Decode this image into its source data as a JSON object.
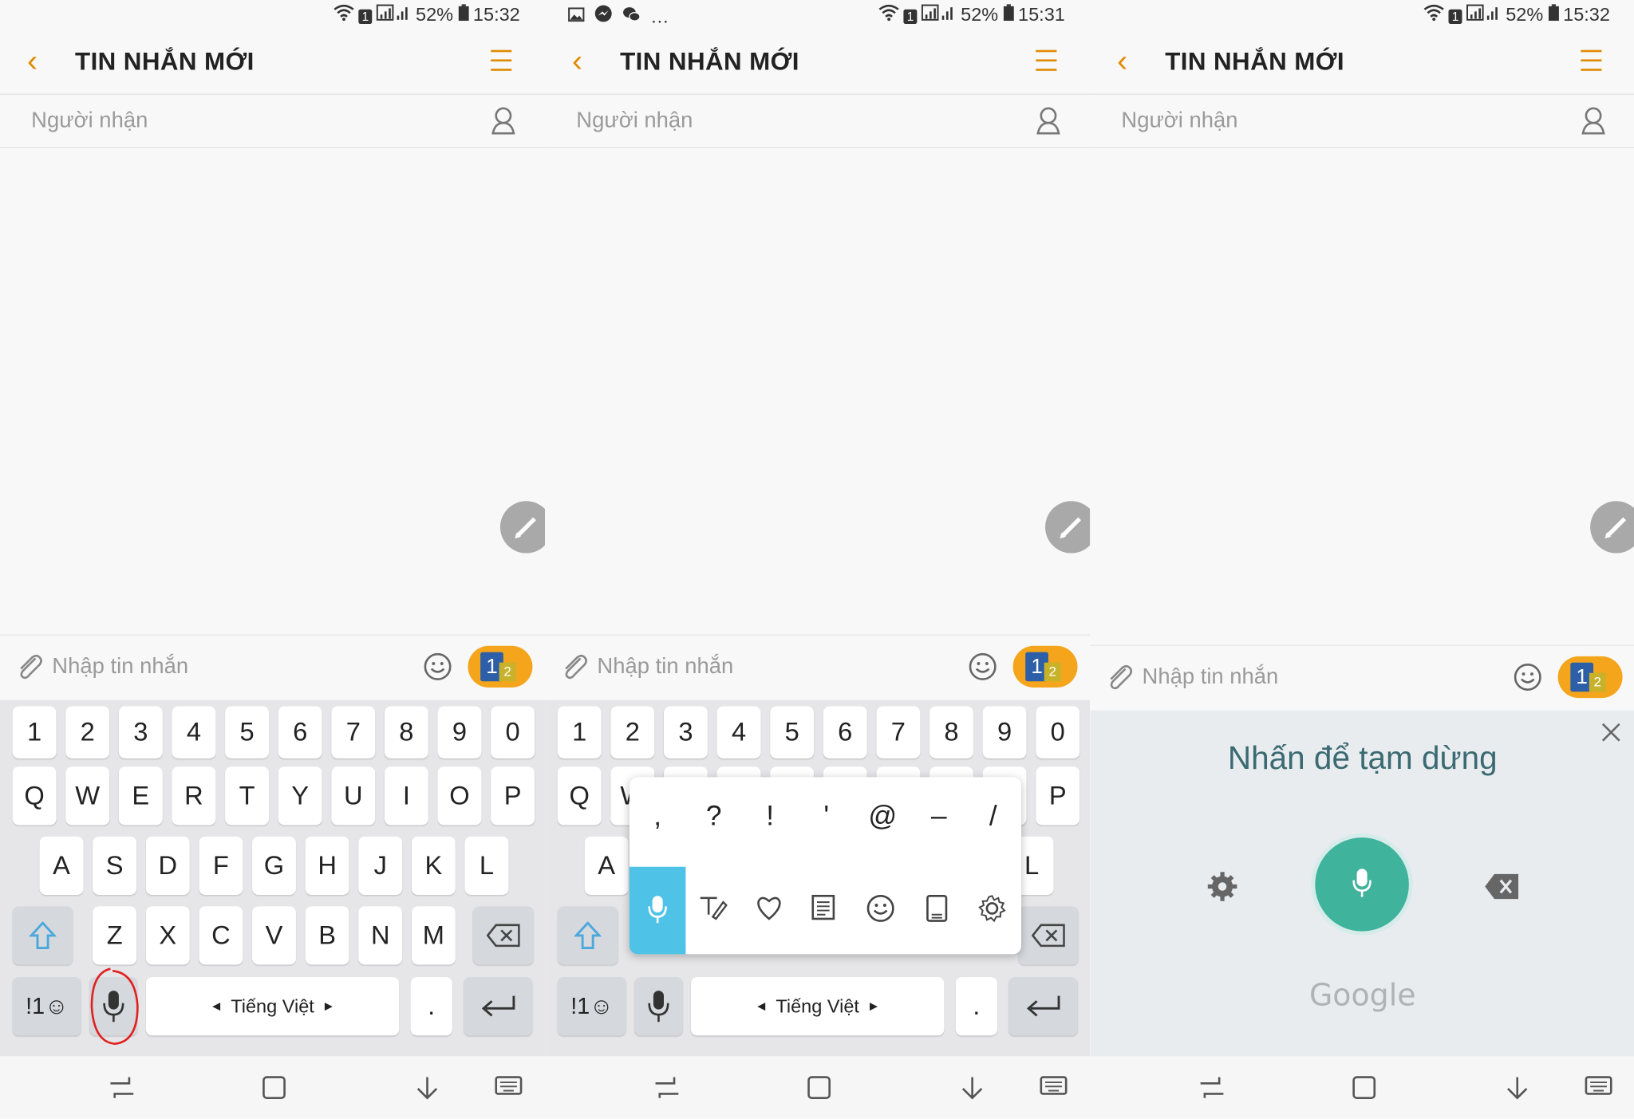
{
  "status_left": "…",
  "panels": [
    {
      "status": {
        "battery": "52%",
        "time": "15:32",
        "sim": "1"
      }
    },
    {
      "status": {
        "battery": "52%",
        "time": "15:31",
        "sim": "1"
      }
    },
    {
      "status": {
        "battery": "52%",
        "time": "15:32",
        "sim": "1"
      }
    }
  ],
  "appbar": {
    "title": "TIN NHẮN MỚI"
  },
  "recipient": {
    "placeholder": "Người nhận"
  },
  "composer": {
    "placeholder": "Nhập tin nhắn",
    "sim_badge": "1",
    "sim_badge_sub": "2"
  },
  "keyboard": {
    "numbers": [
      "1",
      "2",
      "3",
      "4",
      "5",
      "6",
      "7",
      "8",
      "9",
      "0"
    ],
    "row1": [
      "Q",
      "W",
      "E",
      "R",
      "T",
      "Y",
      "U",
      "I",
      "O",
      "P"
    ],
    "row2": [
      "A",
      "S",
      "D",
      "F",
      "G",
      "H",
      "J",
      "K",
      "L"
    ],
    "row3": [
      "Z",
      "X",
      "C",
      "V",
      "B",
      "N",
      "M"
    ],
    "sym_key": "!1☺",
    "space_label": "Tiếng Việt",
    "period": "."
  },
  "popup": {
    "symbols": [
      ",",
      "?",
      "!",
      "'",
      "@",
      "–",
      "/"
    ]
  },
  "voice": {
    "prompt": "Nhấn để tạm dừng",
    "brand": "Google"
  },
  "colors": {
    "accent": "#e08a00",
    "send": "#f4a51c",
    "voice_mic": "#3fb39c",
    "popup_selected": "#4fc2e8"
  }
}
